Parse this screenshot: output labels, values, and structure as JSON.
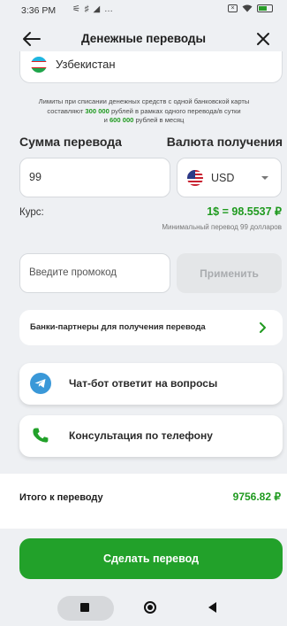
{
  "status_bar": {
    "time": "3:36 PM",
    "left_icons": "⚟ ♯ ◢ …"
  },
  "header": {
    "title": "Денежные переводы"
  },
  "country": {
    "name": "Узбекистан"
  },
  "limits": {
    "line1": "Лимиты при списании денежных средств с одной банковской карты",
    "line2_prefix": "составляют ",
    "per_transfer_amount": "300 000",
    "line2_suffix": " рублей в рамках одного перевода/в сутки",
    "line3_prefix": "и ",
    "monthly_amount": "600 000",
    "line3_suffix": " рублей в месяц"
  },
  "transfer": {
    "amount_label": "Сумма перевода",
    "currency_label": "Валюта получения",
    "amount_value": "99",
    "currency_code": "USD"
  },
  "rate": {
    "label": "Курс:",
    "value": "1$ = 98.5537 ₽",
    "min_transfer": "Минимальный перевод 99 долларов"
  },
  "promo": {
    "placeholder": "Введите промокод",
    "apply_label": "Применить"
  },
  "partner_banks": {
    "label": "Банки-партнеры для получения перевода"
  },
  "support": {
    "chatbot_label": "Чат-бот ответит на вопросы",
    "phone_label": "Консультация по телефону"
  },
  "total": {
    "label": "Итого к переводу",
    "value": "9756.82 ₽"
  },
  "submit": {
    "label": "Сделать перевод"
  },
  "colors": {
    "accent_green": "#22a12a",
    "text_green": "#1f9a1f",
    "telegram_blue": "#3a98d8",
    "background": "#eef0f3"
  },
  "icons": {
    "back": "arrow-left-icon",
    "close": "close-icon",
    "uz_flag": "uzbekistan-flag-icon",
    "us_flag": "usa-flag-icon",
    "dropdown": "caret-down-icon",
    "chevron": "chevron-right-icon",
    "chatbot": "telegram-icon",
    "phone": "phone-icon"
  }
}
